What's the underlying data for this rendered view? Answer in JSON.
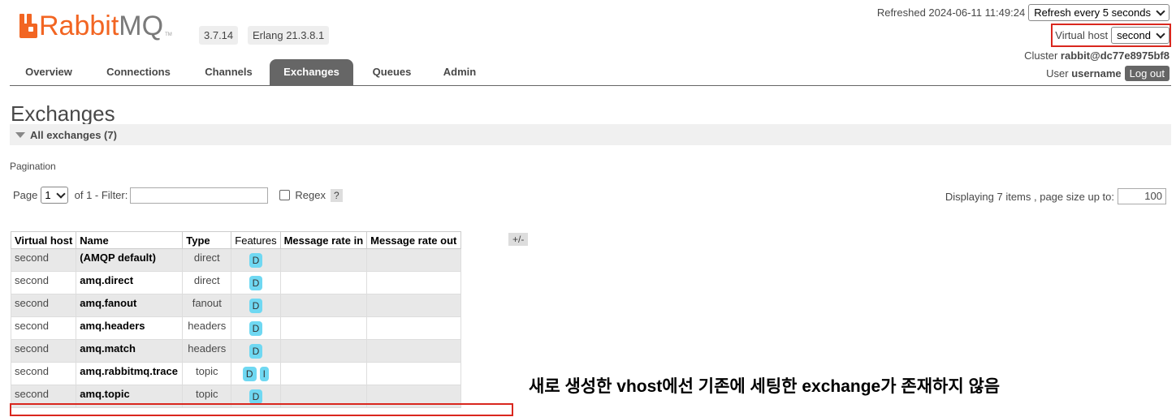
{
  "header": {
    "logo_rabbit": "Rabbit",
    "logo_mq": "MQ",
    "logo_tm": "TM",
    "version": "3.7.14",
    "erlang": "Erlang 21.3.8.1",
    "refreshed": "Refreshed 2024-06-11 11:49:24",
    "refresh_select": "Refresh every 5 seconds",
    "vhost_label": "Virtual host",
    "vhost_select": "second",
    "cluster_label": "Cluster",
    "cluster_name": "rabbit@dc77e8975bf8",
    "user_label": "User",
    "user_name": "username",
    "logout": "Log out"
  },
  "nav": {
    "tabs": [
      "Overview",
      "Connections",
      "Channels",
      "Exchanges",
      "Queues",
      "Admin"
    ],
    "active": "Exchanges"
  },
  "page": {
    "title": "Exchanges",
    "section": "All exchanges (7)",
    "pagination_label": "Pagination",
    "page_label": "Page",
    "page_value": "1",
    "of_label": "of 1  - Filter:",
    "regex_label": "Regex",
    "help": "?",
    "displaying": "Displaying 7 items , page size up to:",
    "page_size": "100",
    "plus_minus": "+/-"
  },
  "table": {
    "headers": [
      "Virtual host",
      "Name",
      "Type",
      "Features",
      "Message rate in",
      "Message rate out"
    ],
    "rows": [
      {
        "vhost": "second",
        "name": "(AMQP default)",
        "type": "direct",
        "features": [
          "D"
        ]
      },
      {
        "vhost": "second",
        "name": "amq.direct",
        "type": "direct",
        "features": [
          "D"
        ]
      },
      {
        "vhost": "second",
        "name": "amq.fanout",
        "type": "fanout",
        "features": [
          "D"
        ]
      },
      {
        "vhost": "second",
        "name": "amq.headers",
        "type": "headers",
        "features": [
          "D"
        ]
      },
      {
        "vhost": "second",
        "name": "amq.match",
        "type": "headers",
        "features": [
          "D"
        ]
      },
      {
        "vhost": "second",
        "name": "amq.rabbitmq.trace",
        "type": "topic",
        "features": [
          "D",
          "I"
        ]
      },
      {
        "vhost": "second",
        "name": "amq.topic",
        "type": "topic",
        "features": [
          "D"
        ]
      }
    ]
  },
  "annotation": "새로 생성한 vhost에선 기존에 세팅한 exchange가 존재하지 않음",
  "colors": {
    "accent": "#f26522",
    "highlight": "#d9271e",
    "feature_pill": "#6fd8f2",
    "active_tab": "#666666"
  }
}
